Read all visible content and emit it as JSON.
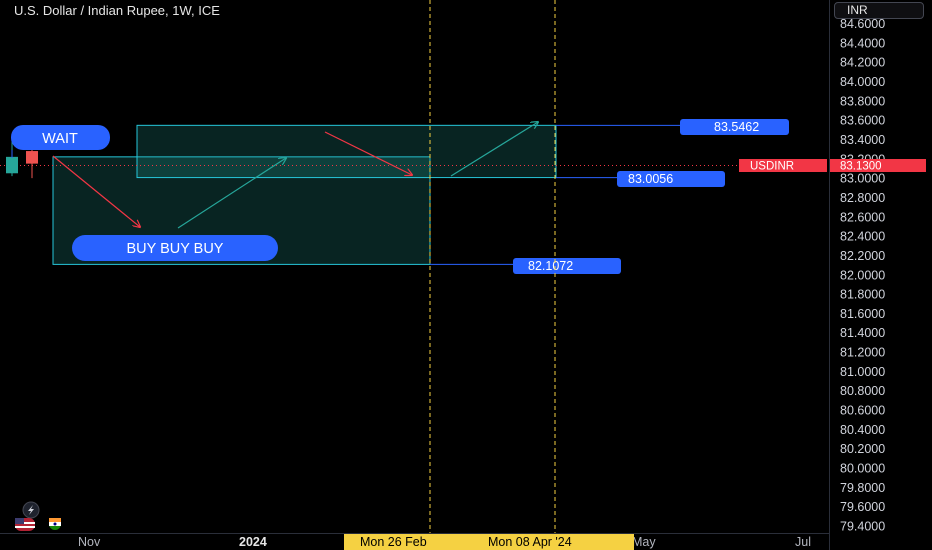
{
  "header": {
    "title": "U.S. Dollar / Indian Rupee, 1W, ICE",
    "currency": "INR"
  },
  "chart_data": {
    "type": "line",
    "title": "U.S. Dollar / Indian Rupee, 1W, ICE",
    "ylim": [
      79.4,
      84.6
    ],
    "y_ticks": [
      84.6,
      84.4,
      84.2,
      84.0,
      83.8,
      83.6,
      83.4,
      83.2,
      83.0,
      82.8,
      82.6,
      82.4,
      82.2,
      82.0,
      81.8,
      81.6,
      81.4,
      81.2,
      81.0,
      80.8,
      80.6,
      80.4,
      80.2,
      80.0,
      79.8,
      79.6,
      79.4
    ],
    "x_ticks": [
      "Nov",
      "2024",
      "May",
      "Jul"
    ],
    "x_ticks_bold": [
      "2024"
    ],
    "crosshair_dates": [
      "Mon 26 Feb",
      "Mon 08 Apr '24"
    ],
    "current_price": {
      "symbol": "USDINR",
      "value": "83.1300",
      "price": 83.13
    },
    "levels": [
      {
        "label": "83.5462",
        "price": 83.5462
      },
      {
        "label": "83.0056",
        "price": 83.0056
      },
      {
        "label": "82.1072",
        "price": 82.1072
      }
    ],
    "annotations": [
      "WAIT",
      "BUY BUY BUY"
    ],
    "candles": [
      {
        "open": 83.05,
        "close": 83.22,
        "high": 83.38,
        "low": 83.02,
        "color": "#26a69a"
      },
      {
        "open": 83.28,
        "close": 83.15,
        "high": 83.32,
        "low": 83.0,
        "color": "#ef5350"
      }
    ],
    "zones": [
      {
        "from_price": 82.1072,
        "to_price": 83.22
      },
      {
        "from_price": 83.0056,
        "to_price": 83.5462
      }
    ],
    "grid": false,
    "colors": {
      "up": "#26a69a",
      "down": "#ef5350",
      "zone_border": "#26c6da",
      "label_bg": "#2962ff",
      "crosshair": "#f5d142",
      "price_tag": "#f23645"
    }
  }
}
